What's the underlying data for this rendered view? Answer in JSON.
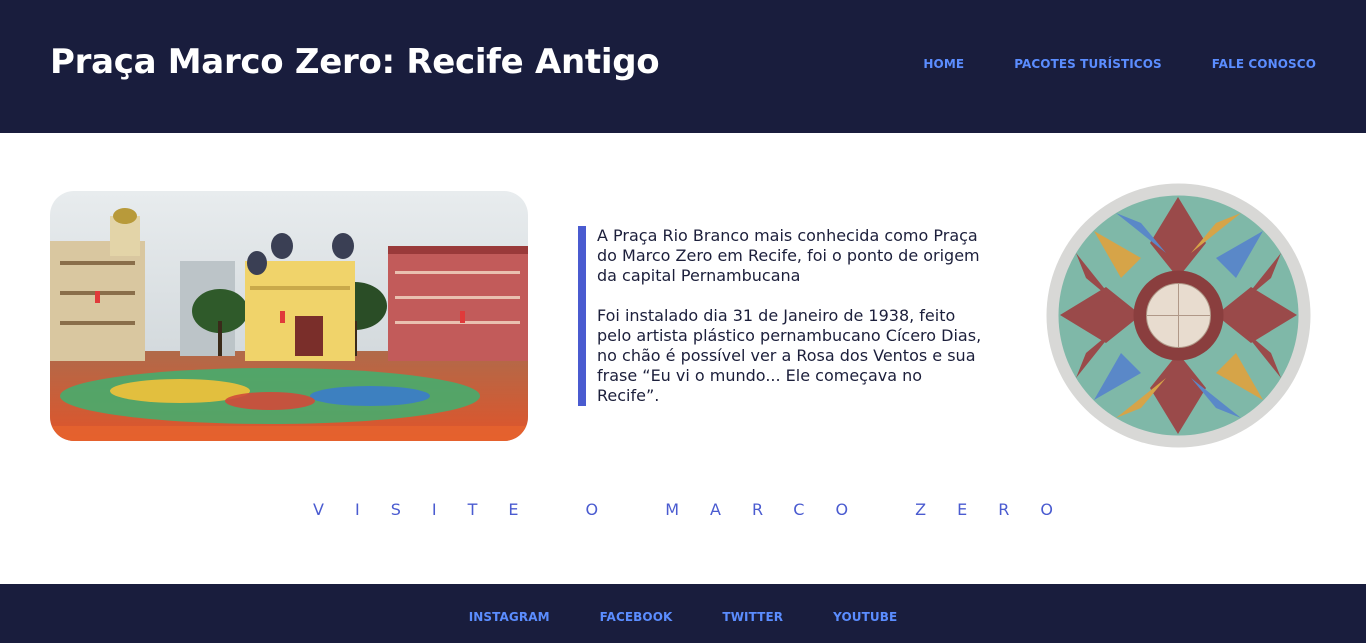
{
  "header": {
    "title": "Praça Marco Zero: Recife Antigo",
    "nav": [
      "HOME",
      "PACOTES TURÍSTICOS",
      "FALE CONOSCO"
    ]
  },
  "main": {
    "paragraphs": [
      "A Praça Rio Branco mais conhecida como Praça do Marco Zero em Recife, foi o ponto de origem da capital Pernambucana",
      "Foi instalado dia 31 de Janeiro de 1938, feito pelo artista plástico pernambucano Cícero Dias, no chão é possível ver a Rosa dos Ventos e sua frase “Eu vi o mundo... Ele começava no Recife”."
    ],
    "cta": "VISITE O MARCO ZERO"
  },
  "footer": {
    "social": [
      "INSTAGRAM",
      "FACEBOOK",
      "TWITTER",
      "YOUTUBE"
    ]
  },
  "colors": {
    "header_bg": "#191d3d",
    "link": "#5b8dff",
    "accent": "#4a5bd0"
  }
}
